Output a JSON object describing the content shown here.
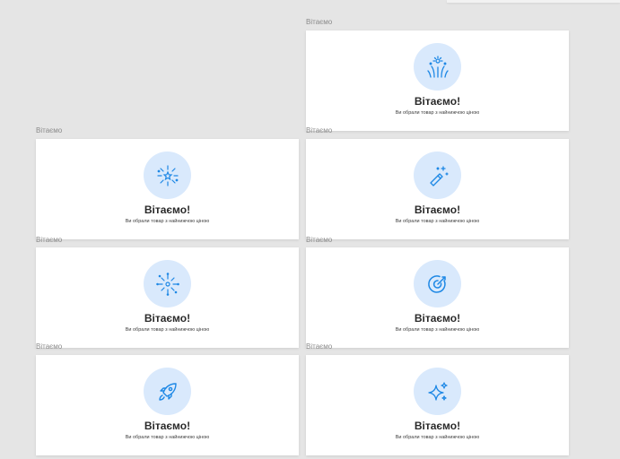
{
  "frames": [
    {
      "label": "Вітаємо",
      "title": "Вітаємо!",
      "subtitle": "Ви обрали товар з найнижчою ціною",
      "icon": "fireworks-icon"
    },
    {
      "label": "Вітаємо",
      "title": "Вітаємо!",
      "subtitle": "Ви обрали товар з найнижчою ціною",
      "icon": "star-burst-icon"
    },
    {
      "label": "Вітаємо",
      "title": "Вітаємо!",
      "subtitle": "Ви обрали товар з найнижчою ціною",
      "icon": "magic-wand-icon"
    },
    {
      "label": "Вітаємо",
      "title": "Вітаємо!",
      "subtitle": "Ви обрали товар з найнижчою ціною",
      "icon": "sparkler-icon"
    },
    {
      "label": "Вітаємо",
      "title": "Вітаємо!",
      "subtitle": "Ви обрали товар з найнижчою ціною",
      "icon": "target-arrow-icon"
    },
    {
      "label": "Вітаємо",
      "title": "Вітаємо!",
      "subtitle": "Ви обрали товар з найнижчою ціною",
      "icon": "rocket-icon"
    },
    {
      "label": "Вітаємо",
      "title": "Вітаємо!",
      "subtitle": "Ви обрали товар з найнижчою ціною",
      "icon": "sparkles-icon"
    }
  ],
  "colors": {
    "canvas": "#e5e5e5",
    "card": "#ffffff",
    "icon_circle": "#d9e9fc",
    "icon_stroke": "#1e88e5",
    "title": "#2a2a2a"
  }
}
